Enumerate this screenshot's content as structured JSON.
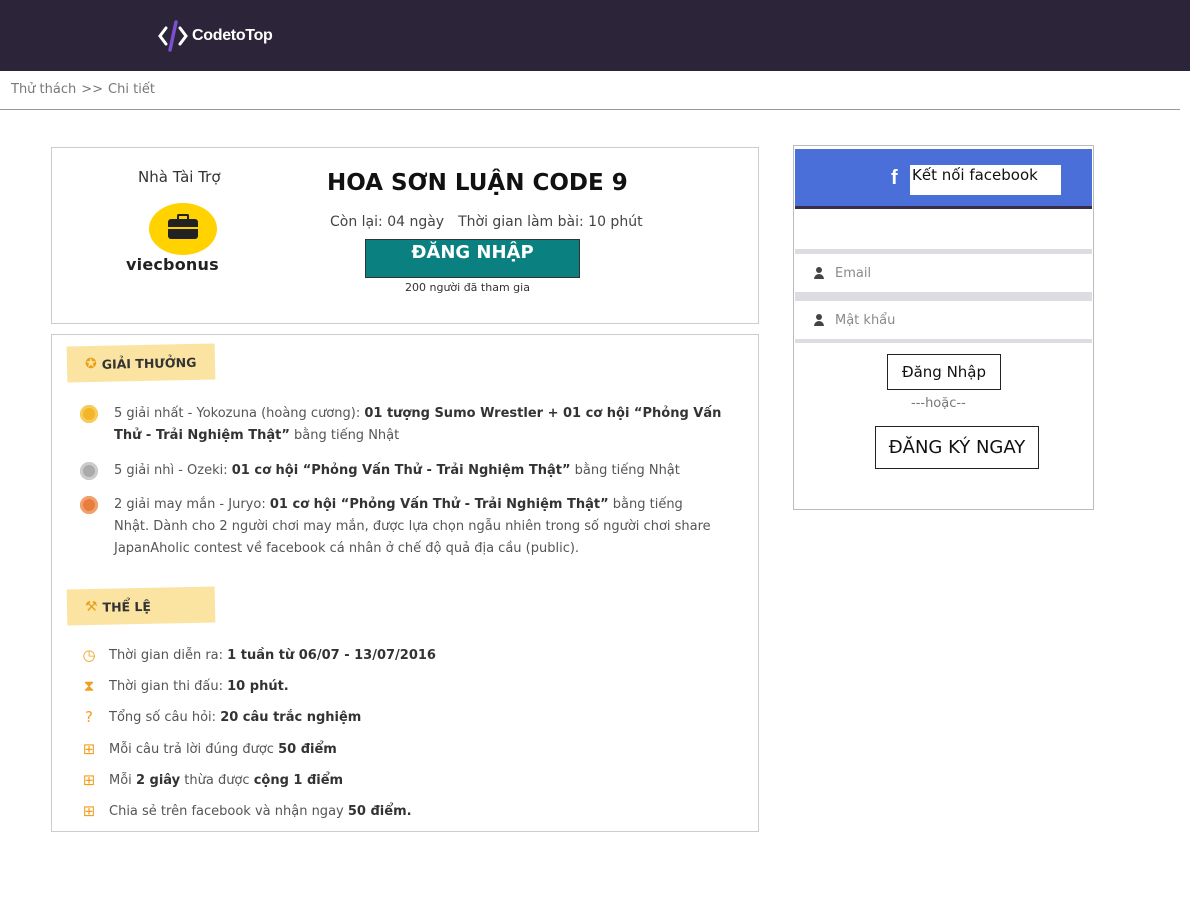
{
  "header": {
    "logo_text": "CodetoTop",
    "background": "#2c2438"
  },
  "breadcrumb": {
    "items": [
      "Thử thách",
      "Chi tiết"
    ],
    "separator": ">>"
  },
  "contest": {
    "sponsor_label": "Nhà Tài Trợ",
    "sponsor_name": "viecbonus",
    "title": "HOA SƠN LUẬN CODE 9",
    "time_left": "Còn lại: 04 ngày",
    "duration": "Thời gian làm bài: 10 phút",
    "login_button": "ĐĂNG NHẬP",
    "participants": "200 người đã tham gia",
    "accent": "#0b8080"
  },
  "prizes": {
    "heading": "GIẢI THƯỞNG",
    "items": [
      {
        "text": "5 giải nhất - Yokozuna (hoàng cương):",
        "bold": "01 tượng Sumo Wrestler + 01 cơ hội “Phỏng Vấn Thử - Trải Nghiệm Thật”",
        "tail": "bằng tiếng Nhật",
        "icon": "gold-medal-icon"
      },
      {
        "text": "5 giải nhì - Ozeki:",
        "bold": "01 cơ hội “Phỏng Vấn Thử - Trải Nghiệm Thật”",
        "tail": "bằng tiếng Nhật",
        "icon": "silver-medal-icon"
      },
      {
        "text": "2 giải may mắn - Juryo:",
        "bold": "01 cơ hội “Phỏng Vấn Thử - Trải Nghiệm Thật”",
        "tail": "bằng tiếng Nhật. Dành cho 2 người chơi may mắn, được lựa chọn ngẫu nhiên trong số người chơi share JapanAholic contest về facebook cá nhân ở chế độ quả địa cầu (public).",
        "icon": "bronze-medal-icon"
      }
    ]
  },
  "rules": {
    "heading": "THỂ LỆ",
    "items": [
      {
        "text": "Thời gian diễn ra:",
        "bold": "1 tuần từ 06/07 - 13/07/2016",
        "icon": "clock-icon"
      },
      {
        "text": "Thời gian thi đấu:",
        "bold": "10 phút.",
        "icon": "hourglass-icon"
      },
      {
        "text": "Tổng số câu hỏi:",
        "bold": "20 câu trắc nghiệm",
        "icon": "question-icon"
      },
      {
        "text": "Mỗi câu trả lời đúng được",
        "bold": "50 điểm",
        "icon": "gift-icon"
      },
      {
        "text": "Mỗi",
        "bold": "2 giây",
        "tail": "thừa được",
        "bold2": "cộng 1 điểm",
        "icon": "gift-icon"
      },
      {
        "text": "Chia sẻ trên facebook và nhận ngay",
        "bold": "50 điểm.",
        "icon": "gift-icon"
      }
    ]
  },
  "login": {
    "facebook_label": "Kết nối facebook",
    "email_placeholder": "Email",
    "password_placeholder": "Mật khẩu",
    "login_button": "Đăng Nhập",
    "or_text": "---hoặc--",
    "register_button": "ĐĂNG KÝ NGAY",
    "facebook_color": "#4a6fd8"
  }
}
